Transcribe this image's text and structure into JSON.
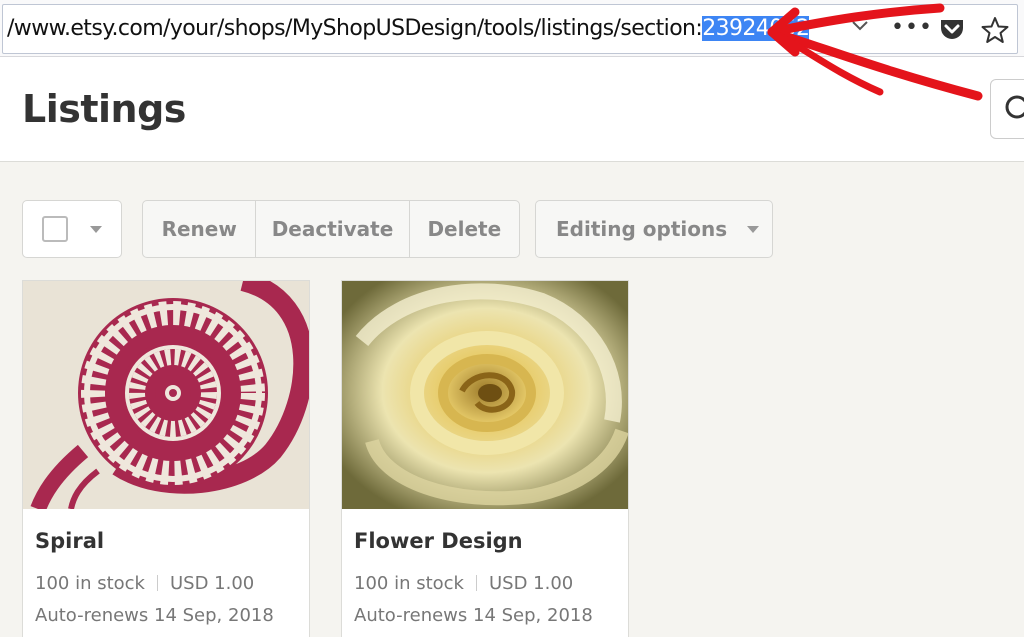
{
  "browser": {
    "url_prefix": "/www.etsy.com/your/shops/MyShopUSDesign/tools/listings/section:",
    "url_selected": "23924052",
    "more_icon": "•••"
  },
  "page": {
    "title": "Listings"
  },
  "toolbar": {
    "renew_label": "Renew",
    "deactivate_label": "Deactivate",
    "delete_label": "Delete",
    "editing_options_label": "Editing options"
  },
  "listings": [
    {
      "title": "Spiral",
      "stock": "100 in stock",
      "price": "USD 1.00",
      "renew": "Auto-renews 14 Sep, 2018"
    },
    {
      "title": "Flower Design",
      "stock": "100 in stock",
      "price": "USD 1.00",
      "renew": "Auto-renews 14 Sep, 2018"
    }
  ],
  "colors": {
    "selection": "#3d85f4",
    "annotation_arrow": "#e4141b",
    "spiral_ink": "#a8284f",
    "rose_petal": "#e8dfa0"
  }
}
